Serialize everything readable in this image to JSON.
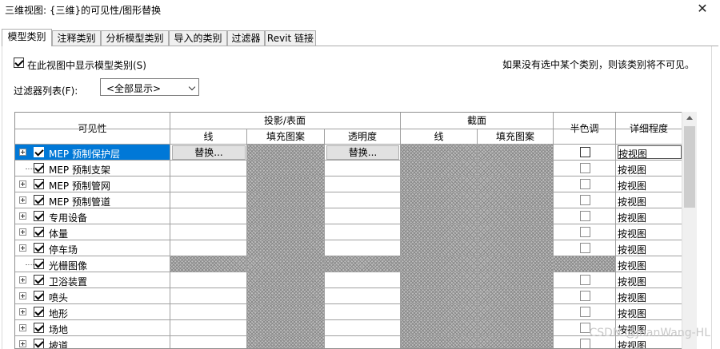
{
  "window": {
    "title": "三维视图: {三维}的可见性/图形替换",
    "close_glyph": "✕"
  },
  "tabs": [
    {
      "label": "模型类别",
      "active": true
    },
    {
      "label": "注释类别",
      "active": false
    },
    {
      "label": "分析模型类别",
      "active": false
    },
    {
      "label": "导入的类别",
      "active": false
    },
    {
      "label": "过滤器",
      "active": false
    },
    {
      "label": "Revit 链接",
      "active": false
    }
  ],
  "show_categories": {
    "label": "在此视图中显示模型类别(S)",
    "checked": true
  },
  "hint": "如果没有选中某个类别，则该类别将不可见。",
  "filter_list": {
    "label": "过滤器列表(F):",
    "value": "<全部显示>"
  },
  "headers": {
    "visibility": "可见性",
    "projection": "投影/表面",
    "cut": "截面",
    "halftone": "半色调",
    "detail_level": "详细程度",
    "line": "线",
    "fill_pattern": "填充图案",
    "transparency": "透明度",
    "cut_line": "线",
    "cut_fill_pattern": "填充图案"
  },
  "override_button": "替换...",
  "rows": [
    {
      "name": "MEP 预制保护层",
      "expandable": true,
      "checked": true,
      "selected": true,
      "detail": "按视图"
    },
    {
      "name": "MEP 预制支架",
      "expandable": false,
      "checked": true,
      "selected": false,
      "detail": "按视图"
    },
    {
      "name": "MEP 预制管网",
      "expandable": true,
      "checked": true,
      "selected": false,
      "detail": "按视图"
    },
    {
      "name": "MEP 预制管道",
      "expandable": true,
      "checked": true,
      "selected": false,
      "detail": "按视图"
    },
    {
      "name": "专用设备",
      "expandable": true,
      "checked": true,
      "selected": false,
      "detail": "按视图"
    },
    {
      "name": "体量",
      "expandable": true,
      "checked": true,
      "selected": false,
      "detail": "按视图"
    },
    {
      "name": "停车场",
      "expandable": true,
      "checked": true,
      "selected": false,
      "detail": "按视图"
    },
    {
      "name": "光栅图像",
      "expandable": false,
      "checked": true,
      "selected": false,
      "detail": "按视图"
    },
    {
      "name": "卫浴装置",
      "expandable": true,
      "checked": true,
      "selected": false,
      "detail": "按视图"
    },
    {
      "name": "喷头",
      "expandable": true,
      "checked": true,
      "selected": false,
      "detail": "按视图"
    },
    {
      "name": "地形",
      "expandable": true,
      "checked": true,
      "selected": false,
      "detail": "按视图"
    },
    {
      "name": "场地",
      "expandable": true,
      "checked": true,
      "selected": false,
      "detail": "按视图"
    },
    {
      "name": "坡道",
      "expandable": true,
      "checked": true,
      "selected": false,
      "detail": "按视图"
    }
  ],
  "watermark": "CSDN @JuanWang-HL",
  "colors": {
    "selection": "#0078d7",
    "hatch": "#8a8a8a"
  }
}
